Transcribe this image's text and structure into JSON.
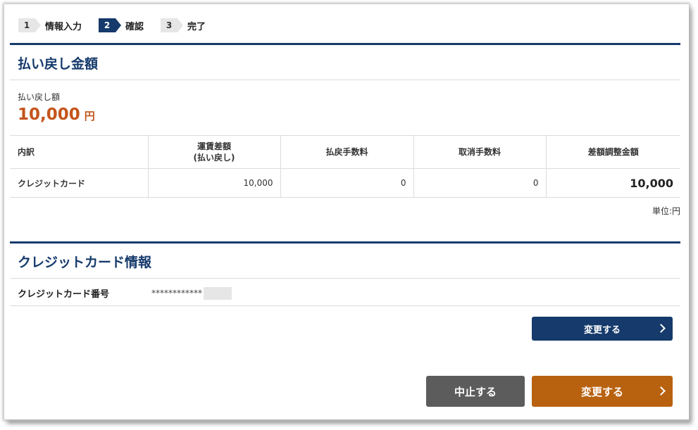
{
  "steps": [
    {
      "num": "1",
      "label": "情報入力"
    },
    {
      "num": "2",
      "label": "確認"
    },
    {
      "num": "3",
      "label": "完了"
    }
  ],
  "refund_section": {
    "title": "払い戻し金額",
    "caption": "払い戻し額",
    "amount": "10,000",
    "currency": "円"
  },
  "breakdown": {
    "headers": [
      "内訳",
      "運賃差額",
      "(払い戻し)",
      "払戻手数料",
      "取消手数料",
      "差額調整金額"
    ],
    "row": {
      "method": "クレジットカード",
      "fare_difference": "10,000",
      "refund_fee": "0",
      "cancel_fee": "0",
      "adjustment_total": "10,000"
    },
    "unit_note": "単位:円"
  },
  "card_section": {
    "title": "クレジットカード情報",
    "label": "クレジットカード番号",
    "value": "************"
  },
  "buttons": {
    "change_card": "変更する",
    "cancel": "中止する",
    "submit": "変更する"
  },
  "colors": {
    "navy": "#153a6b",
    "amount_orange": "#c4551b",
    "submit_orange": "#b8620f",
    "cancel_gray": "#5c5c5c"
  }
}
